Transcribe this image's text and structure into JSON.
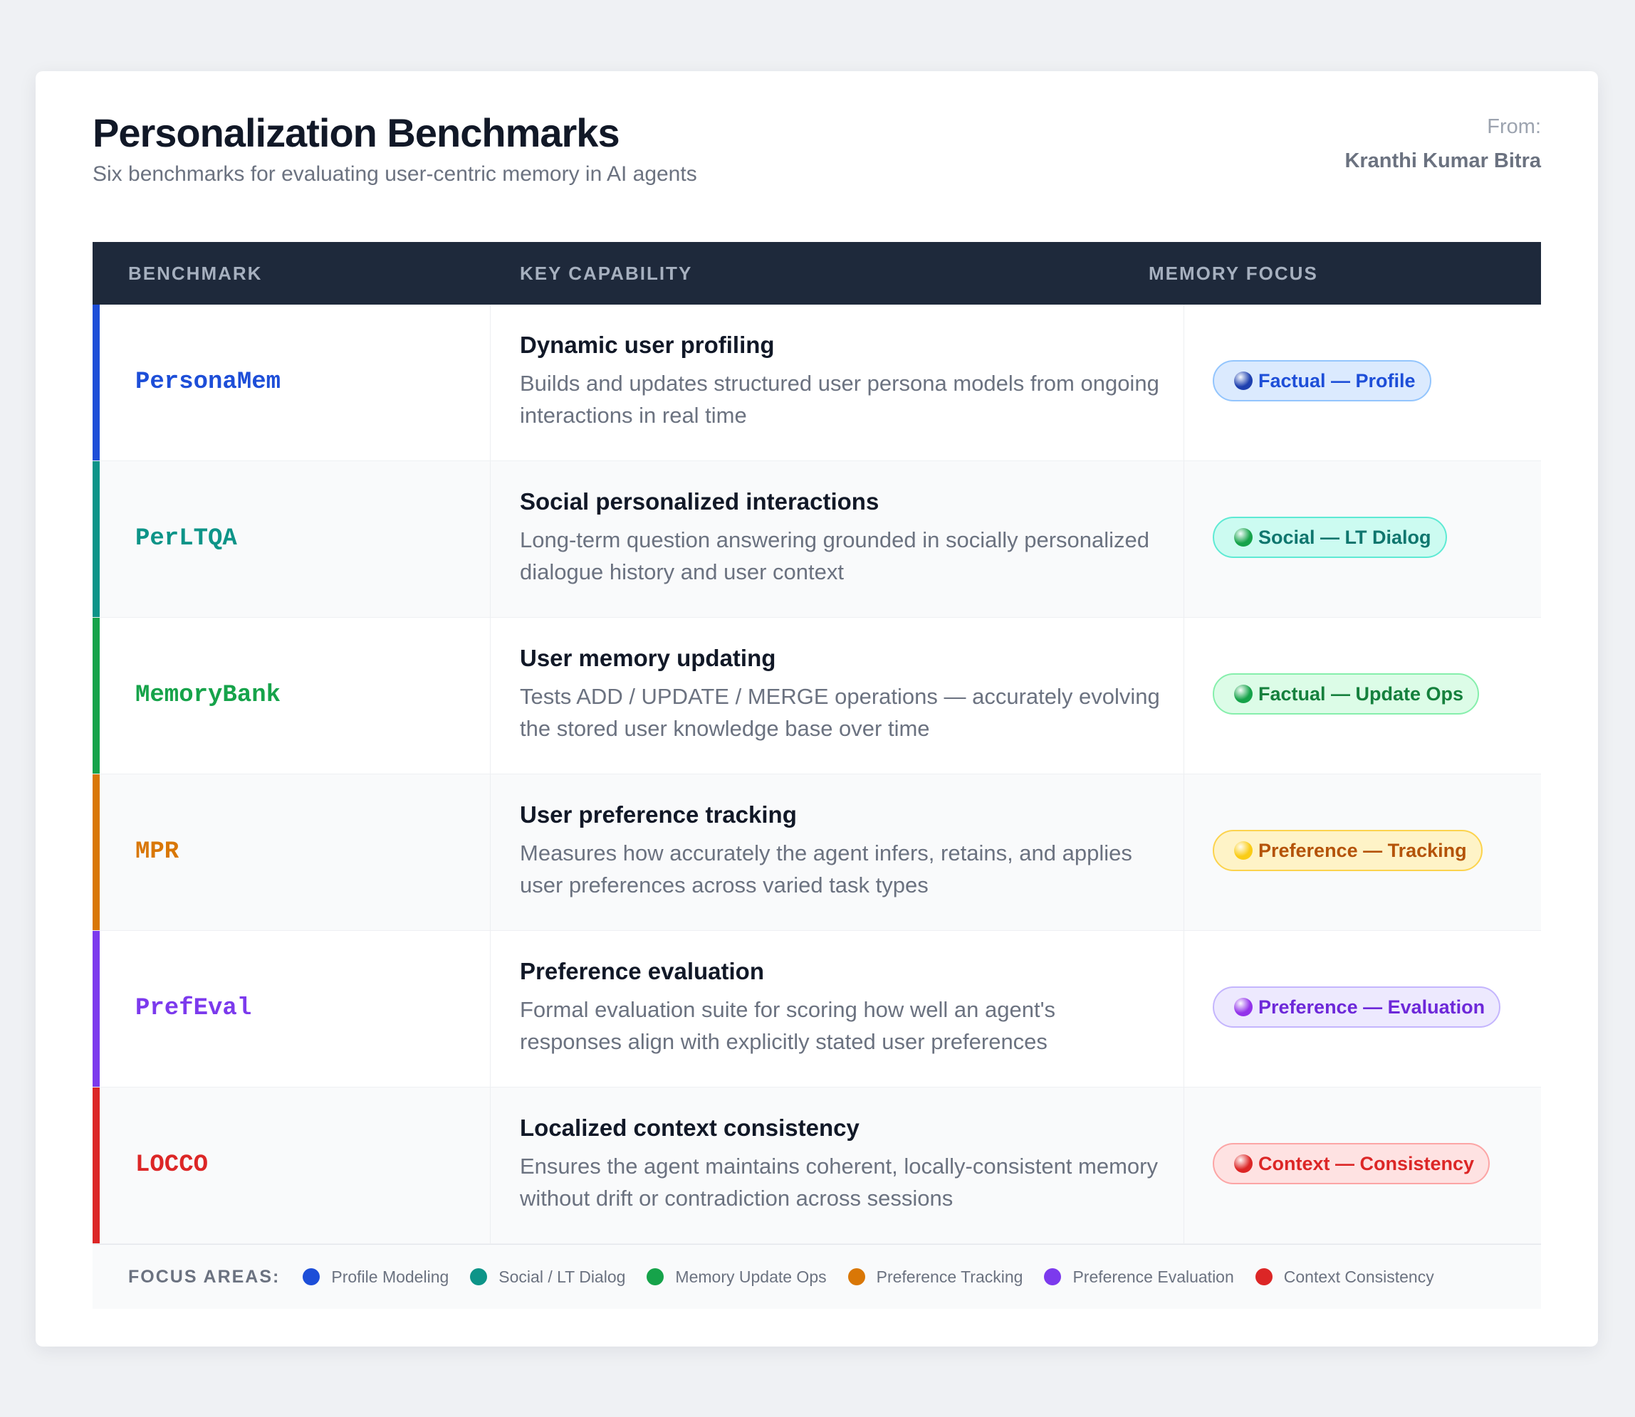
{
  "header": {
    "title": "Personalization Benchmarks",
    "subtitle": "Six benchmarks for evaluating user-centric memory in AI agents",
    "from_label": "From:",
    "from_name": "Kranthi Kumar Bitra"
  },
  "table": {
    "columns": [
      "BENCHMARK",
      "KEY CAPABILITY",
      "MEMORY FOCUS"
    ],
    "rows": [
      {
        "benchmark": "PersonaMem",
        "capability": "Dynamic user profiling",
        "description": "Builds and updates structured user persona models from ongoing interactions in real time",
        "focus": "Factual — Profile",
        "color": "#1d4ed8",
        "pill_bg": "#dbeafe",
        "pill_border": "#93c5fd",
        "pill_text": "#1d4ed8",
        "dot": "#1e40af"
      },
      {
        "benchmark": "PerLTQA",
        "capability": "Social personalized interactions",
        "description": "Long-term question answering grounded in socially personalized dialogue history and user context",
        "focus": "Social — LT Dialog",
        "color": "#0d9488",
        "pill_bg": "#ccfbf1",
        "pill_border": "#5eead4",
        "pill_text": "#0f766e",
        "dot": "#16a34a"
      },
      {
        "benchmark": "MemoryBank",
        "capability": "User memory updating",
        "description": "Tests ADD / UPDATE / MERGE operations — accurately evolving the stored user knowledge base over time",
        "focus": "Factual — Update Ops",
        "color": "#16a34a",
        "pill_bg": "#dcfce7",
        "pill_border": "#86efac",
        "pill_text": "#15803d",
        "dot": "#16a34a"
      },
      {
        "benchmark": "MPR",
        "capability": "User preference tracking",
        "description": "Measures how accurately the agent infers, retains, and applies user preferences across varied task types",
        "focus": "Preference — Tracking",
        "color": "#d97706",
        "pill_bg": "#fef3c7",
        "pill_border": "#fcd34d",
        "pill_text": "#b45309",
        "dot": "#facc15"
      },
      {
        "benchmark": "PrefEval",
        "capability": "Preference evaluation",
        "description": "Formal evaluation suite for scoring how well an agent's responses align with explicitly stated user preferences",
        "focus": "Preference — Evaluation",
        "color": "#7c3aed",
        "pill_bg": "#ede9fe",
        "pill_border": "#c4b5fd",
        "pill_text": "#6d28d9",
        "dot": "#9333ea"
      },
      {
        "benchmark": "LOCCO",
        "capability": "Localized context consistency",
        "description": "Ensures the agent maintains coherent, locally-consistent memory without drift or contradiction across sessions",
        "focus": "Context — Consistency",
        "color": "#dc2626",
        "pill_bg": "#fee2e2",
        "pill_border": "#fca5a5",
        "pill_text": "#dc2626",
        "dot": "#dc2626"
      }
    ]
  },
  "legend": {
    "title": "FOCUS AREAS:",
    "items": [
      {
        "label": "Profile Modeling",
        "color": "#1d4ed8"
      },
      {
        "label": "Social / LT Dialog",
        "color": "#0d9488"
      },
      {
        "label": "Memory Update Ops",
        "color": "#16a34a"
      },
      {
        "label": "Preference Tracking",
        "color": "#d97706"
      },
      {
        "label": "Preference Evaluation",
        "color": "#7c3aed"
      },
      {
        "label": "Context Consistency",
        "color": "#dc2626"
      }
    ]
  }
}
